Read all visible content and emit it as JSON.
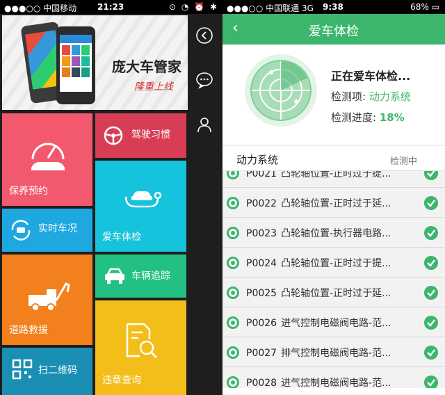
{
  "left": {
    "status_bar": {
      "carrier": "●●●○○ 中国移动",
      "time": "21:23",
      "icons": "⊙ ◔ ⏰ ✱"
    },
    "banner": {
      "title": "庞大车管家",
      "subtitle": "隆重上线"
    },
    "tiles": {
      "maintenance": "保养预约",
      "driving_habits": "驾驶习惯",
      "car_check": "爱车体检",
      "live_status": "实时车况",
      "tracking": "车辆追踪",
      "road_rescue": "道路救援",
      "scan_qr": "扫二维码",
      "violations": "违章查询"
    },
    "icons": {
      "back": "chevron-left-icon",
      "chat": "chat-bubble-icon",
      "profile": "user-icon"
    }
  },
  "right": {
    "status_bar": {
      "carrier": "●●●○○ 中国联通 3G",
      "time": "9:38",
      "battery": "68%"
    },
    "navbar": {
      "title": "爱车体检",
      "back": "‹"
    },
    "status": {
      "title": "正在爱车体检...",
      "item_label": "检测项: ",
      "item_value": "动力系统",
      "progress_label": "检测进度: ",
      "progress_value": "18%"
    },
    "section": {
      "name": "动力系统",
      "state": "检测中"
    },
    "rows": [
      {
        "code": "P0021",
        "desc": "凸轮轴位置-正时过于提..."
      },
      {
        "code": "P0022",
        "desc": "凸轮轴位置-正时过于延..."
      },
      {
        "code": "P0023",
        "desc": "凸轮轴位置-执行器电路..."
      },
      {
        "code": "P0024",
        "desc": "凸轮轴位置-正时过于提..."
      },
      {
        "code": "P0025",
        "desc": "凸轮轴位置-正时过于延..."
      },
      {
        "code": "P0026",
        "desc": "进气控制电磁阀电路-范..."
      },
      {
        "code": "P0027",
        "desc": "排气控制电磁阀电路-范..."
      },
      {
        "code": "P0028",
        "desc": "进气控制电磁阀电路-范..."
      }
    ]
  },
  "colors": {
    "green": "#3cb66c",
    "pink": "#f2596e",
    "red": "#d73e56",
    "cyan": "#16c3dc",
    "sky": "#1fa7e0",
    "teal": "#22c183",
    "orange": "#f2801c",
    "yellow": "#f3bd1a",
    "navy": "#1a8fb3"
  }
}
